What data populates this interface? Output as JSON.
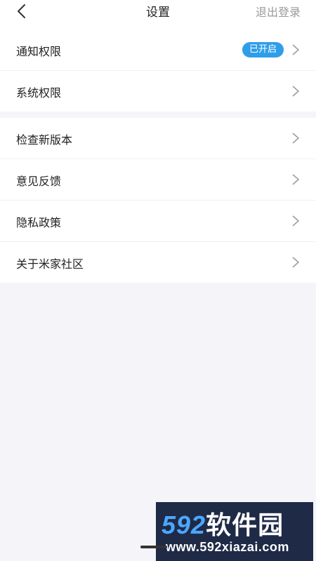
{
  "header": {
    "title": "设置",
    "logout_label": "退出登录"
  },
  "group1": {
    "items": [
      {
        "label": "通知权限",
        "badge": "已开启"
      },
      {
        "label": "系统权限"
      }
    ]
  },
  "group2": {
    "items": [
      {
        "label": "检查新版本"
      },
      {
        "label": "意见反馈"
      },
      {
        "label": "隐私政策"
      },
      {
        "label": "关于米家社区"
      }
    ]
  },
  "watermark": {
    "brand_number": "592",
    "brand_text": "软件园",
    "url": "www.592xiazai.com"
  },
  "colors": {
    "badge": "#2f9ee9",
    "page_background": "#f5f5f9",
    "watermark_background": "#1f2a47"
  }
}
